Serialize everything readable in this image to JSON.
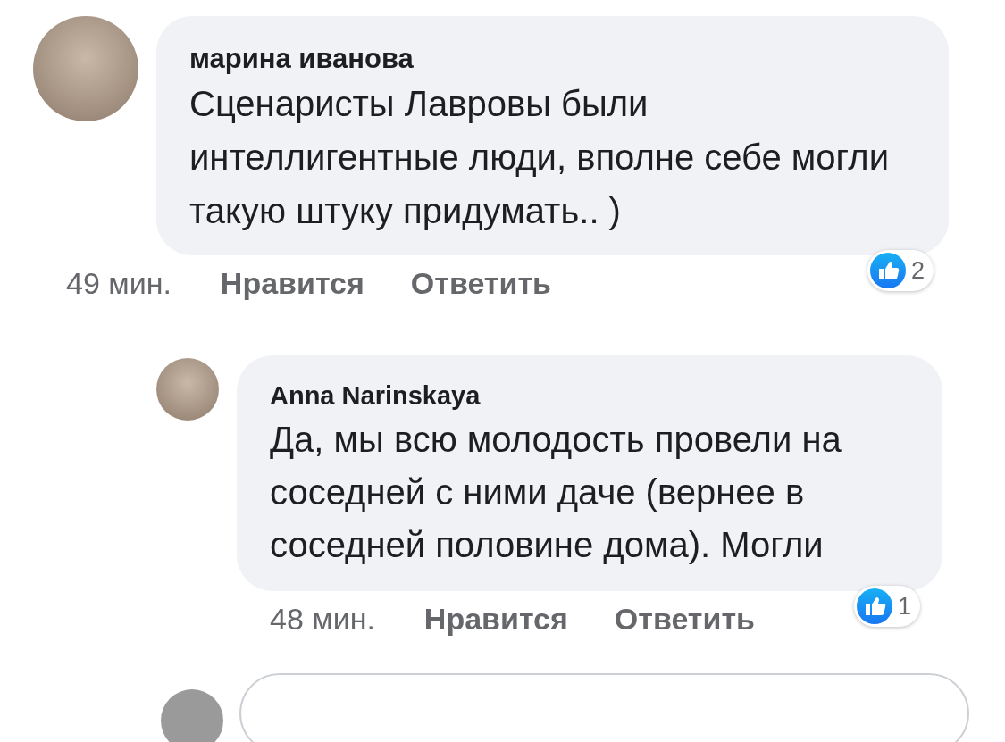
{
  "comments": [
    {
      "kind": "comment",
      "author": "марина иванова",
      "text": "Сценаристы Лавровы были интеллигентные люди, вполне себе могли такую штуку придумать.. )",
      "time": "49 мин.",
      "like": "Нравится",
      "reply": "Ответить",
      "reactions": "2"
    },
    {
      "kind": "reply",
      "author": "Anna Narinskaya",
      "text": "Да, мы всю молодость провели на соседней с ними даче (вернее в соседней половине дома). Могли",
      "time": "48 мин.",
      "like": "Нравится",
      "reply": "Ответить",
      "reactions": "1"
    }
  ],
  "reply_field": {
    "kind": "reply"
  }
}
